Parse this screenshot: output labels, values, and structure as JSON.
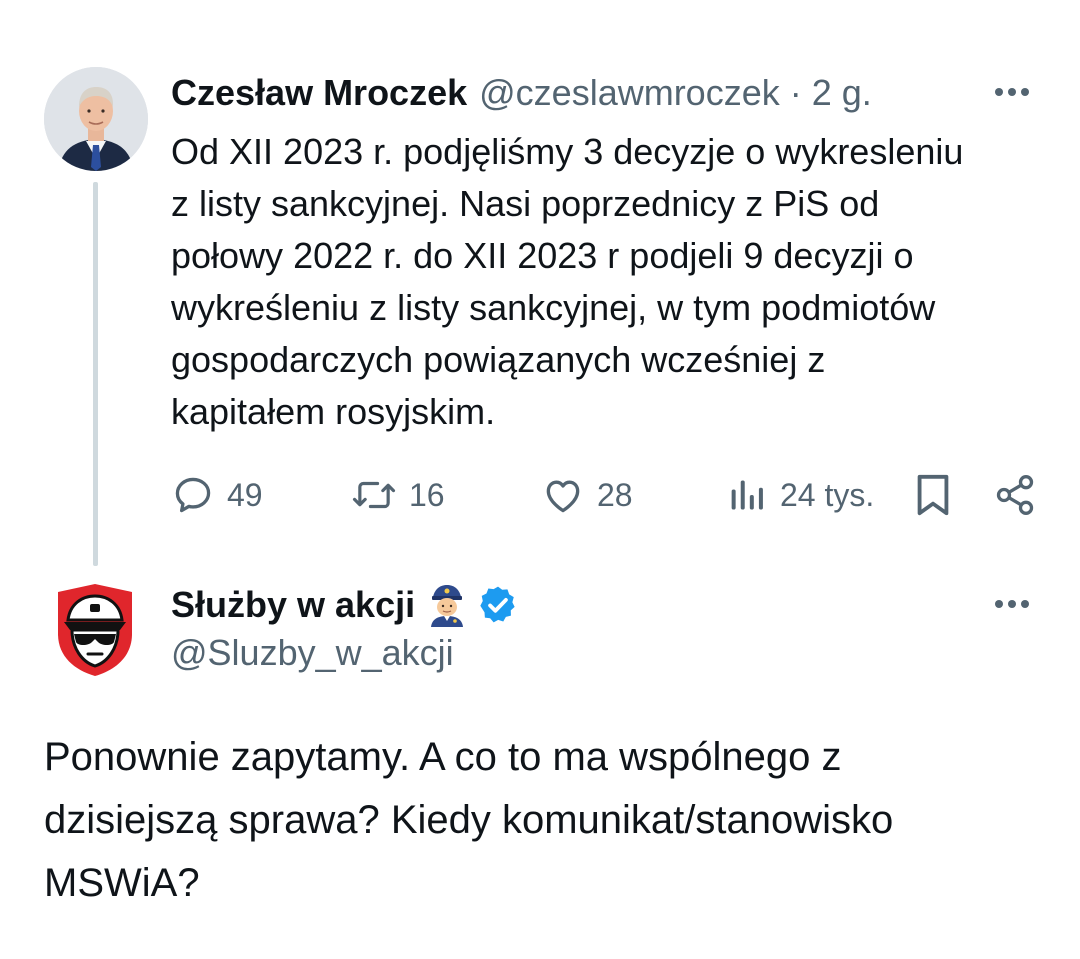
{
  "tweet1": {
    "author_name": "Czesław Mroczek",
    "handle": "@czeslawmroczek",
    "separator": "·",
    "time": "2 g.",
    "text": "Od XII 2023 r. podjęliśmy 3 decyzje o wykresleniu\nz listy sankcyjnej. Nasi poprzednicy z PiS od\npołowy 2022 r. do XII 2023 r podjeli 9 decyzji o\nwykreśleniu z listy sankcyjnej, w tym podmiotów\ngospodarczych powiązanych wcześniej z\nkapitałem rosyjskim.",
    "stats": {
      "replies": "49",
      "retweets": "16",
      "likes": "28",
      "views": "24 tys."
    }
  },
  "tweet2": {
    "author_name": "Służby w akcji",
    "handle": "@Sluzby_w_akcji",
    "verified": true,
    "text": "Ponownie zapytamy. A co to ma wspólnego z\ndzisiejszą sprawa? Kiedy komunikat/stanowisko\nMSWiA?"
  },
  "icons": {
    "more": "more-horizontal-icon",
    "reply": "reply-icon",
    "retweet": "retweet-icon",
    "like": "heart-icon",
    "views": "views-chart-icon",
    "bookmark": "bookmark-icon",
    "share": "share-icon",
    "verified": "verified-badge-icon",
    "emoji": "police-officer-emoji-icon"
  },
  "colors": {
    "text": "#0f1419",
    "secondary": "#536471",
    "thread_line": "#cfd9de",
    "verified": "#1d9bf0",
    "logo_red": "#e0262c"
  }
}
